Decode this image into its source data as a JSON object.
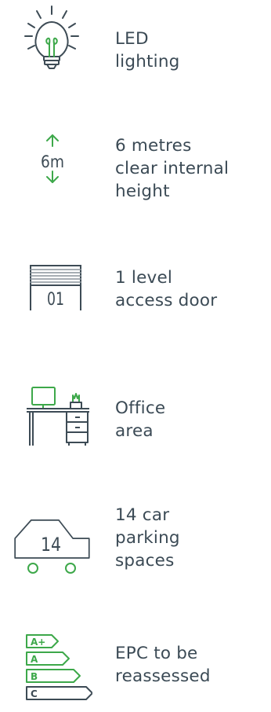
{
  "colors": {
    "icon_stroke": "#3d4b55",
    "accent_green": "#3da84a",
    "text": "#3b4a55",
    "background": "#ffffff"
  },
  "features": [
    {
      "icon": "light-bulb-icon",
      "lines": [
        "LED",
        "lighting"
      ]
    },
    {
      "icon": "height-arrows-icon",
      "icon_text": "6m",
      "lines": [
        "6 metres",
        "clear internal",
        "height"
      ]
    },
    {
      "icon": "roller-door-icon",
      "icon_text": "01",
      "lines": [
        "1 level",
        "access door"
      ]
    },
    {
      "icon": "office-desk-icon",
      "lines": [
        "Office",
        "area"
      ]
    },
    {
      "icon": "car-icon",
      "icon_text": "14",
      "lines": [
        "14 car",
        "parking",
        "spaces"
      ]
    },
    {
      "icon": "energy-rating-icon",
      "ratings": [
        "A+",
        "A",
        "B",
        "C"
      ],
      "lines": [
        "EPC to be",
        "reassessed"
      ]
    }
  ]
}
